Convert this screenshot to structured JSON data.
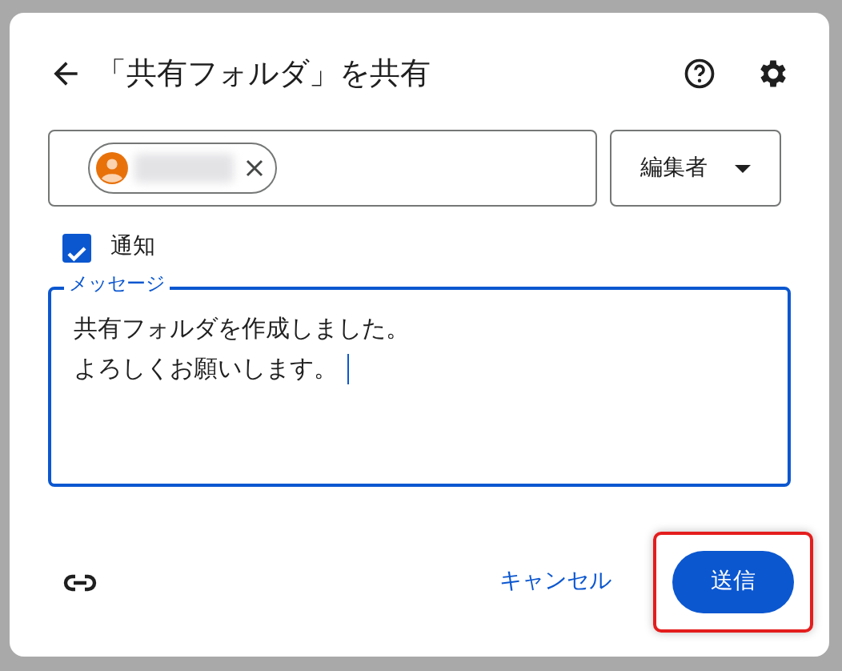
{
  "dialog": {
    "title": "「共有フォルダ」を共有"
  },
  "recipient": {
    "chip": {
      "redacted": true
    }
  },
  "role": {
    "label": "編集者"
  },
  "notify": {
    "label": "通知",
    "checked": true
  },
  "message": {
    "label": "メッセージ",
    "lines": [
      "共有フォルダを作成しました。",
      "よろしくお願いします。"
    ],
    "focused": true
  },
  "buttons": [
    {
      "kind": "text",
      "label": "キャンセル",
      "highlighted": false
    },
    {
      "kind": "filled",
      "label": "送信",
      "highlighted": true
    }
  ]
}
